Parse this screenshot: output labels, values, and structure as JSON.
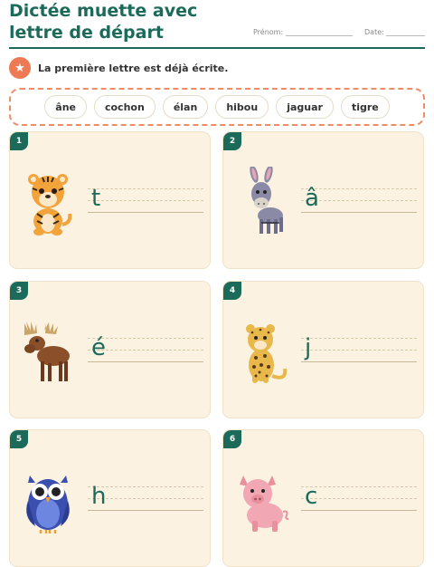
{
  "header": {
    "title": "Dictée muette avec lettre de départ",
    "prenom_label": "Prénom:",
    "date_label": "Date:"
  },
  "instruction": {
    "icon": "star-icon",
    "text": "La première lettre est déjà écrite."
  },
  "word_bank": [
    "âne",
    "cochon",
    "élan",
    "hibou",
    "jaguar",
    "tigre"
  ],
  "cards": [
    {
      "number": "1",
      "animal": "tiger",
      "letter": "t"
    },
    {
      "number": "2",
      "animal": "donkey",
      "letter": "â"
    },
    {
      "number": "3",
      "animal": "moose",
      "letter": "é"
    },
    {
      "number": "4",
      "animal": "jaguar",
      "letter": "j"
    },
    {
      "number": "5",
      "animal": "owl",
      "letter": "h"
    },
    {
      "number": "6",
      "animal": "pig",
      "letter": "c"
    }
  ],
  "colors": {
    "accent": "#1c6b5a",
    "orange": "#ee7a55",
    "card_bg": "#fbf2e2"
  }
}
